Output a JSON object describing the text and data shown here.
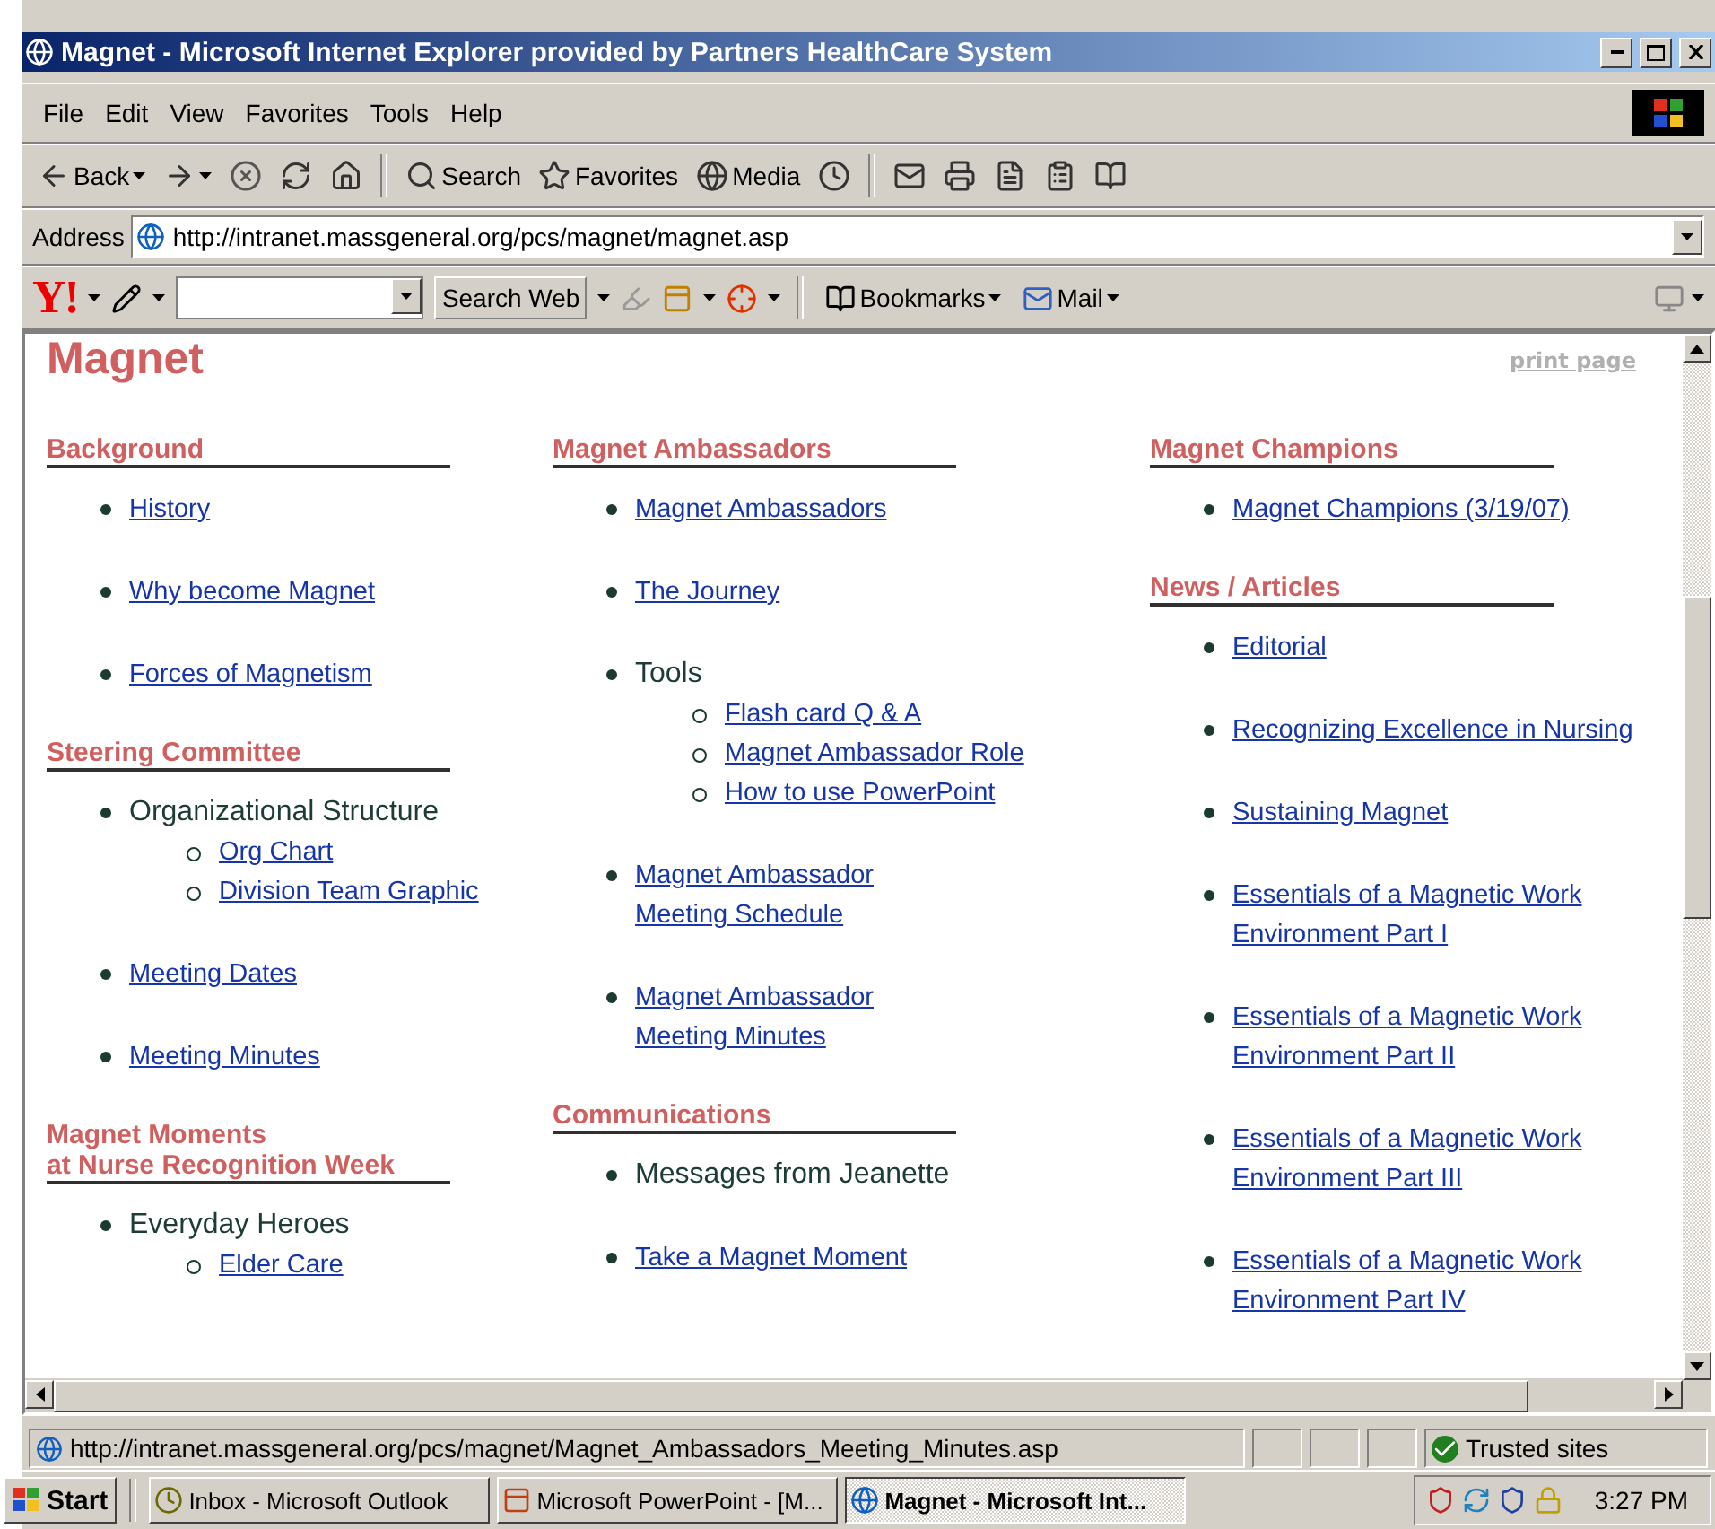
{
  "window": {
    "title": "Magnet - Microsoft Internet Explorer provided by Partners HealthCare System"
  },
  "menu": [
    "File",
    "Edit",
    "View",
    "Favorites",
    "Tools",
    "Help"
  ],
  "toolbar": [
    {
      "kind": "back",
      "label": "Back"
    },
    {
      "kind": "forward"
    },
    {
      "kind": "stop"
    },
    {
      "kind": "refresh"
    },
    {
      "kind": "home"
    },
    {
      "kind": "separator"
    },
    {
      "kind": "search",
      "label": "Search"
    },
    {
      "kind": "favorites",
      "label": "Favorites"
    },
    {
      "kind": "media",
      "label": "Media"
    },
    {
      "kind": "history"
    },
    {
      "kind": "separator"
    },
    {
      "kind": "mail"
    },
    {
      "kind": "print"
    },
    {
      "kind": "word"
    },
    {
      "kind": "edit"
    },
    {
      "kind": "research"
    }
  ],
  "address": {
    "label": "Address",
    "url": "http://intranet.massgeneral.org/pcs/magnet/magnet.asp"
  },
  "yahoo_bar": {
    "logo": "Y!",
    "search_button": "Search Web",
    "bookmarks": "Bookmarks",
    "mail": "Mail"
  },
  "page": {
    "title": "Magnet",
    "print_link": "print page",
    "columns": [
      [
        {
          "heading": [
            "Background"
          ],
          "items": [
            {
              "lines": [
                "History"
              ],
              "link": true
            },
            {
              "lines": [
                "Why become Magnet"
              ],
              "link": true
            },
            {
              "lines": [
                "Forces of Magnetism"
              ],
              "link": true
            }
          ]
        },
        {
          "heading": [
            "Steering Committee"
          ],
          "items": [
            {
              "lines": [
                "Organizational Structure"
              ],
              "link": false,
              "children": [
                {
                  "lines": [
                    "Org Chart"
                  ],
                  "link": true
                },
                {
                  "lines": [
                    "Division Team Graphic"
                  ],
                  "link": true
                }
              ]
            },
            {
              "lines": [
                "Meeting Dates"
              ],
              "link": true
            },
            {
              "lines": [
                "Meeting Minutes"
              ],
              "link": true
            }
          ]
        },
        {
          "heading": [
            "Magnet Moments",
            "at Nurse Recognition Week"
          ],
          "items": [
            {
              "lines": [
                "Everyday Heroes"
              ],
              "link": false,
              "children": [
                {
                  "lines": [
                    "Elder Care"
                  ],
                  "link": true
                }
              ]
            }
          ]
        }
      ],
      [
        {
          "heading": [
            "Magnet Ambassadors"
          ],
          "items": [
            {
              "lines": [
                "Magnet Ambassadors"
              ],
              "link": true
            },
            {
              "lines": [
                "The Journey"
              ],
              "link": true
            },
            {
              "lines": [
                "Tools"
              ],
              "link": false,
              "children": [
                {
                  "lines": [
                    "Flash card Q & A"
                  ],
                  "link": true
                },
                {
                  "lines": [
                    "Magnet Ambassador Role"
                  ],
                  "link": true
                },
                {
                  "lines": [
                    "How to use PowerPoint"
                  ],
                  "link": true
                }
              ]
            },
            {
              "lines": [
                "Magnet Ambassador",
                "Meeting Schedule"
              ],
              "link": true
            },
            {
              "lines": [
                "Magnet Ambassador",
                "Meeting Minutes"
              ],
              "link": true
            }
          ]
        },
        {
          "heading": [
            "Communications"
          ],
          "items": [
            {
              "lines": [
                "Messages from Jeanette"
              ],
              "link": false
            },
            {
              "lines": [
                "Take a Magnet Moment"
              ],
              "link": true
            }
          ]
        }
      ],
      [
        {
          "heading": [
            "Magnet Champions"
          ],
          "items": [
            {
              "lines": [
                "Magnet Champions (3/19/07)"
              ],
              "link": true
            }
          ]
        },
        {
          "heading": [
            "News / Articles"
          ],
          "items": [
            {
              "lines": [
                "Editorial"
              ],
              "link": true
            },
            {
              "lines": [
                "Recognizing Excellence in Nursing"
              ],
              "link": true
            },
            {
              "lines": [
                "Sustaining Magnet"
              ],
              "link": true
            },
            {
              "lines": [
                "Essentials of a Magnetic Work",
                "Environment Part I"
              ],
              "link": true
            },
            {
              "lines": [
                "Essentials of a Magnetic Work",
                "Environment Part II"
              ],
              "link": true
            },
            {
              "lines": [
                "Essentials of a Magnetic Work",
                "Environment Part III"
              ],
              "link": true
            },
            {
              "lines": [
                "Essentials of a Magnetic Work",
                "Environment Part IV"
              ],
              "link": true
            }
          ]
        }
      ]
    ]
  },
  "status_bar": {
    "url": "http://intranet.massgeneral.org/pcs/magnet/Magnet_Ambassadors_Meeting_Minutes.asp",
    "zone": "Trusted sites"
  },
  "taskbar": {
    "start": "Start",
    "tasks": [
      {
        "label": "Inbox - Microsoft Outlook",
        "kind": "outlook",
        "selected": false
      },
      {
        "label": "Microsoft PowerPoint - [M...",
        "kind": "powerpoint",
        "selected": false
      },
      {
        "label": "Magnet - Microsoft Int...",
        "kind": "browser",
        "selected": true
      }
    ],
    "clock": "3:27 PM"
  }
}
